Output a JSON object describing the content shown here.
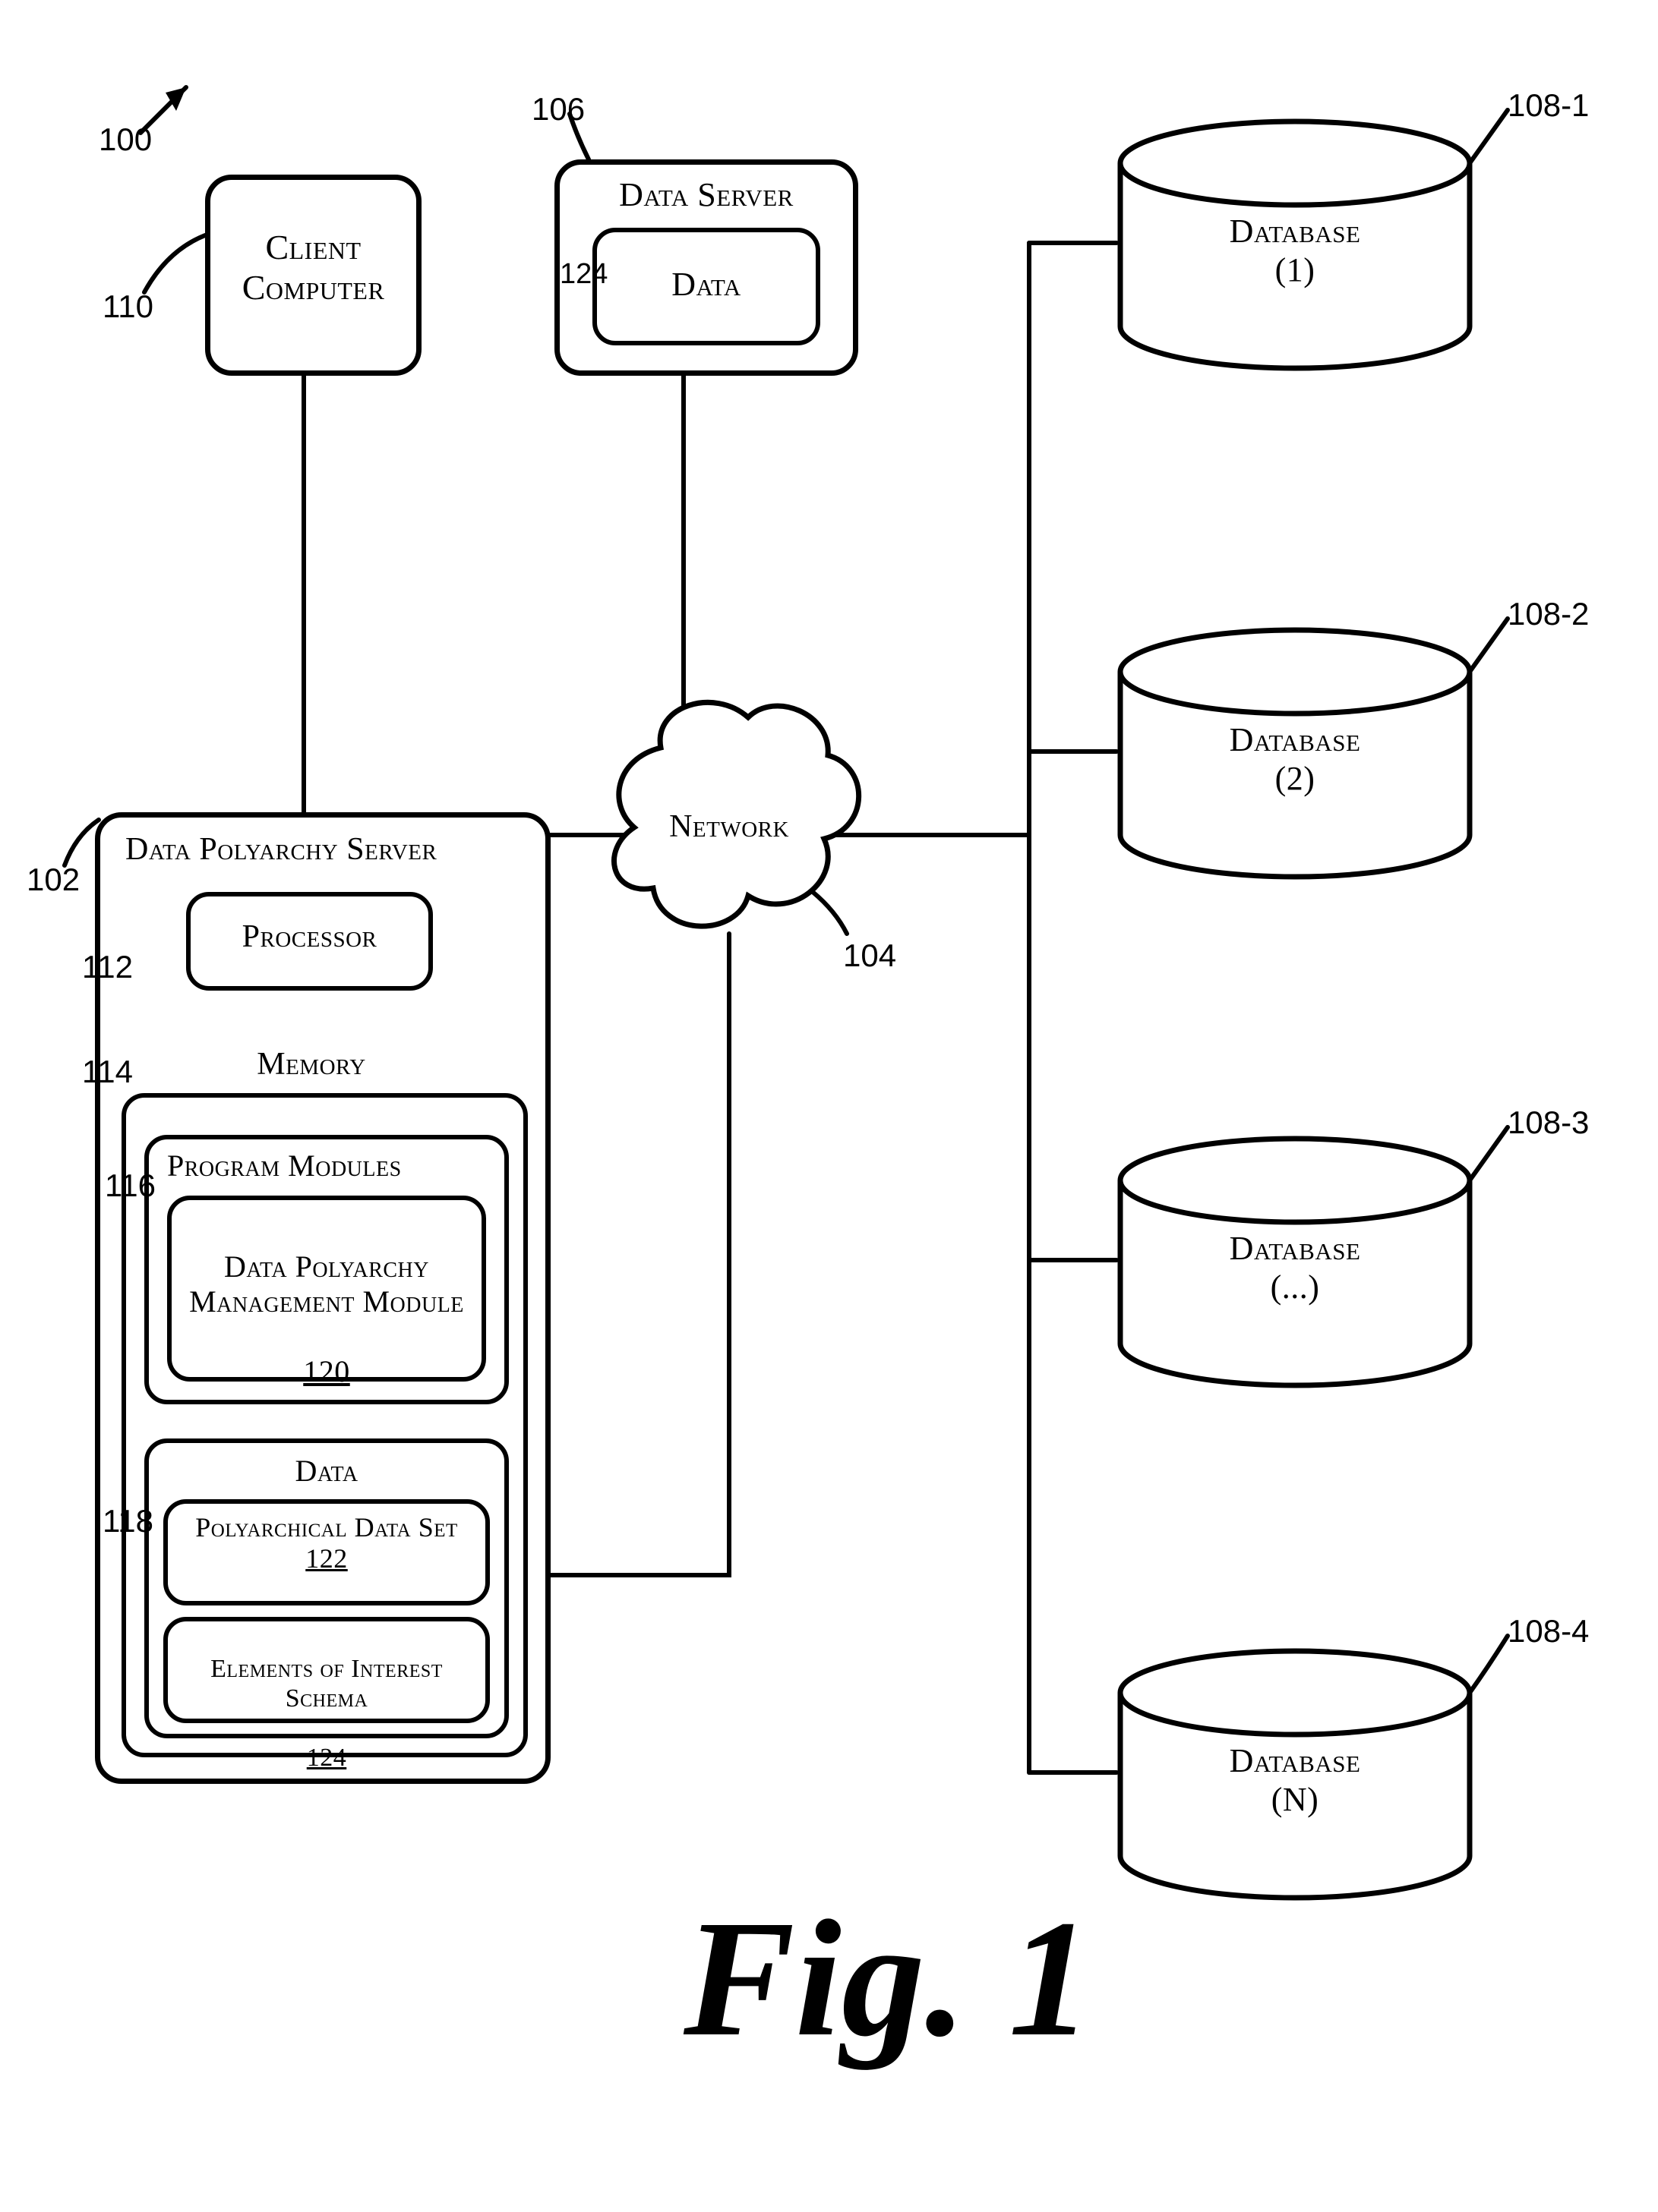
{
  "figure_ref_label": "100",
  "figure_caption": "Fig. 1",
  "client_computer": {
    "label": "Client\nComputer",
    "ref": "110"
  },
  "data_server": {
    "label": "Data Server",
    "data_label": "Data",
    "data_ref": "124",
    "ref": "106"
  },
  "network": {
    "label": "Network",
    "ref": "104"
  },
  "polyarchy_server": {
    "label": "Data Polyarchy Server",
    "ref": "102",
    "processor": {
      "label": "Processor",
      "ref": "112"
    },
    "memory_label": "Memory",
    "memory_ref": "114",
    "program_modules_label": "Program Modules",
    "program_modules_ref": "116",
    "management_module": {
      "label": "Data Polyarchy\nManagement Module",
      "ref": "120"
    },
    "data_section_label": "Data",
    "data_section_ref": "118",
    "polyarchical_data_set": {
      "label": "Polyarchical Data Set",
      "ref": "122"
    },
    "eoi_schema": {
      "label": "Elements of Interest\nSchema",
      "ref": "124"
    }
  },
  "databases": [
    {
      "label": "Database\n(1)",
      "ref": "108-1"
    },
    {
      "label": "Database\n(2)",
      "ref": "108-2"
    },
    {
      "label": "Database\n(...)",
      "ref": "108-3"
    },
    {
      "label": "Database\n(N)",
      "ref": "108-4"
    }
  ]
}
